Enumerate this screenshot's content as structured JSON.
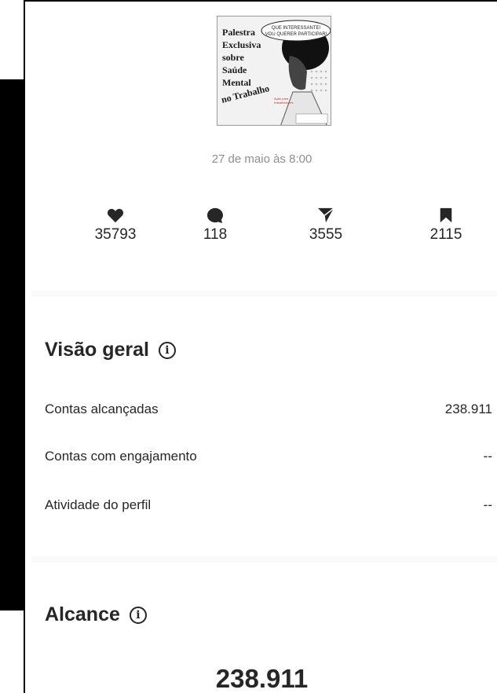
{
  "post": {
    "image_text": {
      "title_lines": [
        "Palestra",
        "Exclusiva",
        "sobre",
        "Saúde",
        "Mental",
        "no Trabalho"
      ],
      "bubble": "QUE INTERESSANTE! VOU QUERER PARTICIPAR!"
    },
    "date": "27 de maio às 8:00"
  },
  "metrics": [
    {
      "icon": "heart-icon",
      "value": "35793"
    },
    {
      "icon": "comment-icon",
      "value": "118"
    },
    {
      "icon": "send-icon",
      "value": "3555"
    },
    {
      "icon": "bookmark-icon",
      "value": "2115"
    }
  ],
  "overview": {
    "title": "Visão geral",
    "rows": [
      {
        "label": "Contas alcançadas",
        "value": "238.911"
      },
      {
        "label": "Contas com engajamento",
        "value": "--"
      },
      {
        "label": "Atividade do perfil",
        "value": "--"
      }
    ]
  },
  "reach": {
    "title": "Alcance",
    "value": "238.911"
  },
  "info_glyph": "i"
}
